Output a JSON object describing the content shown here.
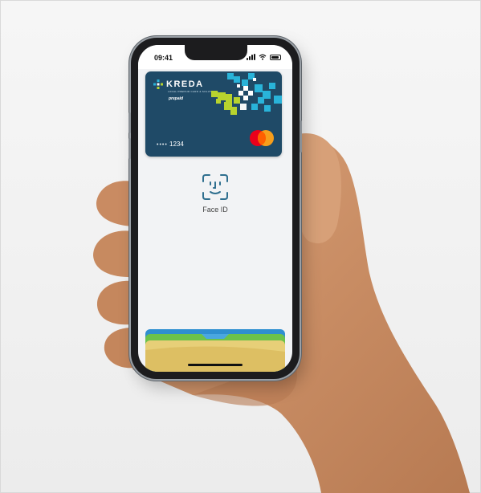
{
  "status_bar": {
    "time": "09:41",
    "icons": [
      "cellular-signal-icon",
      "wifi-icon",
      "battery-icon"
    ]
  },
  "card": {
    "brand": "KREDA",
    "tagline": "LOCAL PREPAID CARD & SOLUTIONS",
    "tier": "prepaid",
    "masked_dots": "••••",
    "last_four": "1234",
    "network_logo": "mastercard-logo",
    "colors": {
      "card_bg": "#1f4a67",
      "accent_cyan": "#29b3d9",
      "accent_green": "#b7d32e",
      "mc_red": "#eb001b",
      "mc_yellow": "#f79e1b"
    }
  },
  "auth": {
    "label": "Face ID",
    "icon": "face-id-icon"
  },
  "wallet_stack": {
    "card_colors": [
      "#2f8fd0",
      "#6cc24a",
      "#e8d070"
    ]
  }
}
